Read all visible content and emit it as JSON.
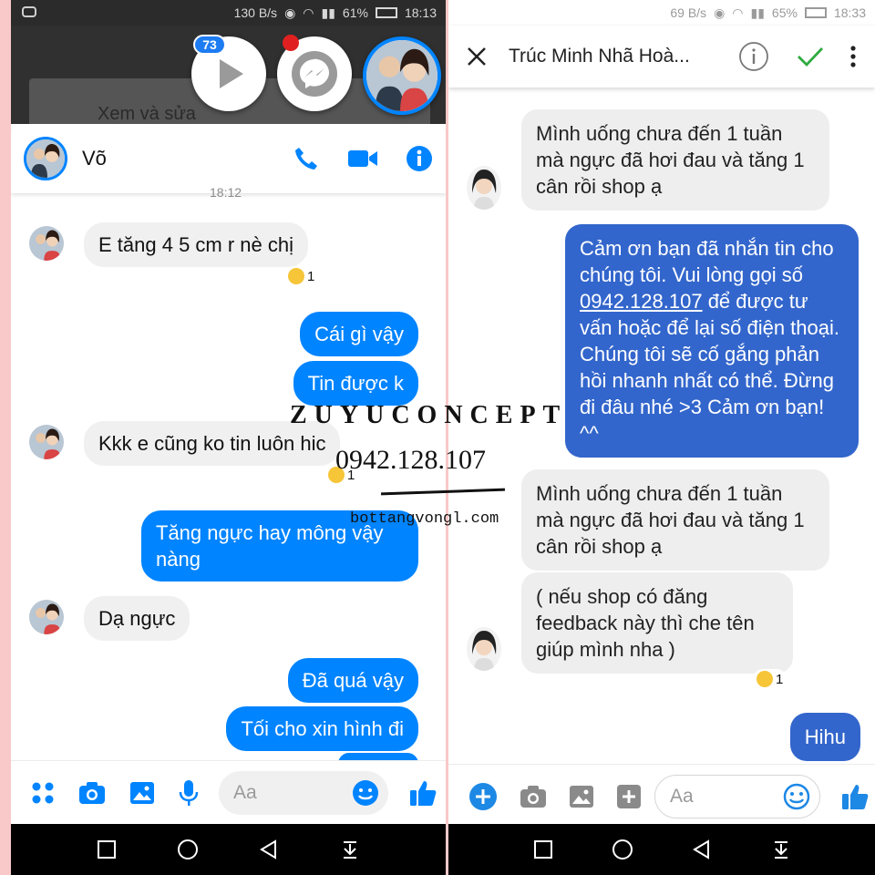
{
  "left": {
    "status": {
      "speed": "130 B/s",
      "battery": "61%",
      "time": "18:13"
    },
    "chat_heads_badge": "73",
    "background_text": "Xem và sửa",
    "contact_name": "Võ",
    "timestamp": "18:12",
    "messages": [
      {
        "text": "E tăng 4 5 cm r nè chị",
        "reaction_count": "1"
      },
      {
        "text": "Cái gì vậy"
      },
      {
        "text": "Tin được k"
      },
      {
        "text": "Kkk e cũng ko tin luôn hic",
        "reaction_count": "1"
      },
      {
        "text": "Tăng ngực hay mông vậy nàng"
      },
      {
        "text": "Dạ ngực"
      },
      {
        "text": "Đã quá vậy"
      },
      {
        "text": "Tối cho xin hình đi"
      }
    ],
    "composer_placeholder": "Aa"
  },
  "right": {
    "status": {
      "speed": "69 B/s",
      "battery": "65%",
      "time": "18:33"
    },
    "title": "Trúc Minh Nhã Hoà...",
    "messages": [
      {
        "text": "Mình uống chưa đến 1 tuần mà ngực đã hơi đau và tăng 1 cân rồi shop ạ"
      },
      {
        "text_before": "Cảm ơn bạn đã nhắn tin cho chúng tôi. Vui lòng gọi số ",
        "phone": "0942.128.107",
        "text_after": " để được tư vấn hoặc để lại số điện thoại. Chúng tôi sẽ cố gắng phản hồi nhanh nhất có thể. Đừng đi đâu nhé >3 Cảm ơn bạn! ^^"
      },
      {
        "text": "Mình uống chưa đến 1 tuần mà ngực đã hơi đau và tăng 1 cân rồi shop ạ"
      },
      {
        "text": "( nếu shop có đăng feedback này thì che tên giúp mình nha )",
        "reaction_count": "1"
      },
      {
        "text": "Hihu"
      }
    ],
    "composer_placeholder": "Aa"
  },
  "watermark": {
    "brand": "ZUYUCONCEPT",
    "phone": "0942.128.107",
    "site": "bottangvongl.com"
  },
  "colors": {
    "messenger_blue": "#0084ff",
    "page_reply_blue": "#3366cc",
    "bubble_grey": "#f1f0f0",
    "confirm_green": "#2eaa3f"
  }
}
